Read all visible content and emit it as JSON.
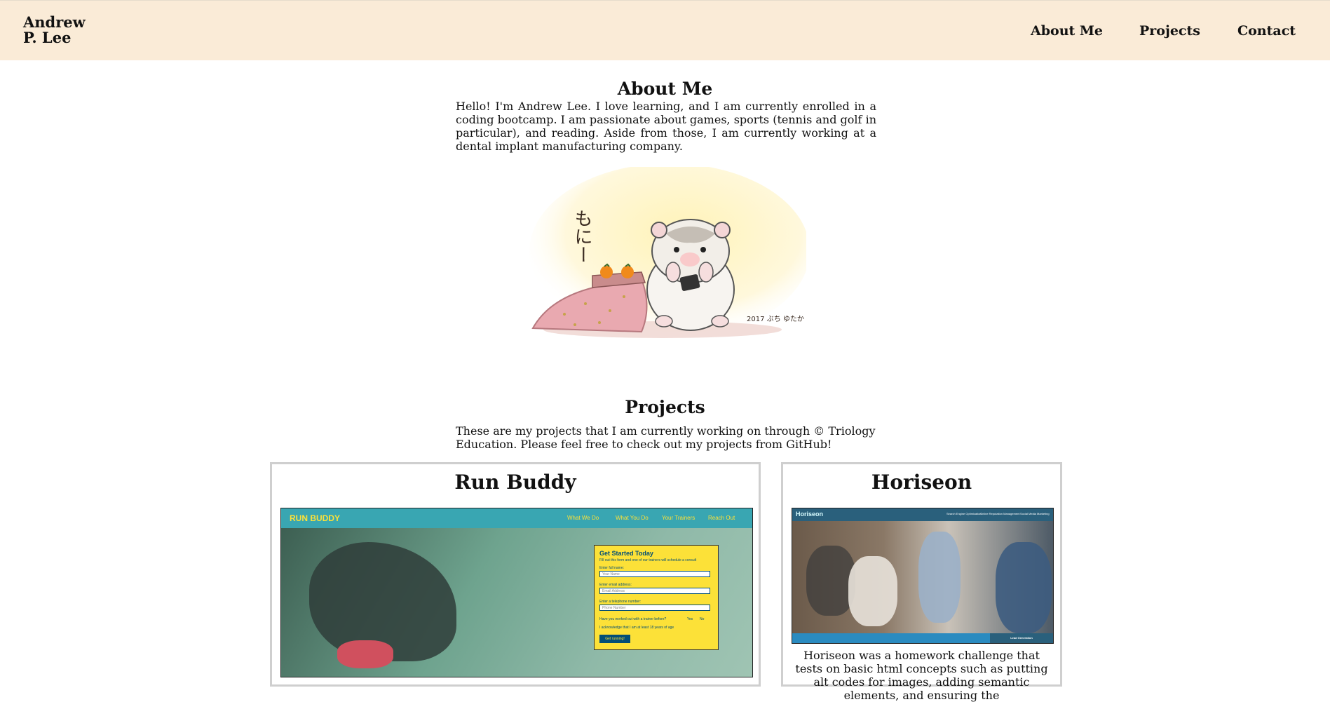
{
  "header": {
    "name_line1": "Andrew",
    "name_line2": "P. Lee",
    "nav": [
      "About Me",
      "Projects",
      "Contact"
    ]
  },
  "about": {
    "title": "About Me",
    "text": "Hello! I'm Andrew Lee. I love learning, and I am currently enrolled in a coding bootcamp. I am passionate about games, sports (tennis and golf in particular), and reading. Aside from those, I am currently working at a dental implant manufacturing company.",
    "image_caption": "もにー",
    "image_signature": "2017 ぶち ゆたか"
  },
  "projects": {
    "title": "Projects",
    "text": "These are my projects that I am currently working on through © Triology Education. Please feel free to check out my projects from GitHub!",
    "cards": [
      {
        "title": "Run Buddy",
        "screenshot": {
          "brand": "RUN BUDDY",
          "nav": [
            "What We Do",
            "What You Do",
            "Your Trainers",
            "Reach Out"
          ],
          "form_title": "Get Started Today",
          "form_sub": "Fill out this form and one of our trainers will schedule a consult",
          "fields": [
            {
              "label": "Enter full name:",
              "placeholder": "Your Name"
            },
            {
              "label": "Enter email address:",
              "placeholder": "Email Address"
            },
            {
              "label": "Enter a telephone number:",
              "placeholder": "Phone Number"
            }
          ],
          "question": "Have you worked out with a trainer before?",
          "yes": "Yes",
          "no": "No",
          "ack": "I acknowledge that I am at least 18 years of age",
          "cta": "Get running!"
        }
      },
      {
        "title": "Horiseon",
        "screenshot": {
          "brand": "Horiseon",
          "nav": [
            "Search Engine Optimization",
            "Online Reputation Management",
            "Social Media Marketing"
          ],
          "footer": "Lead Generation"
        },
        "description": "Horiseon was a homework challenge that tests on basic html concepts such as putting alt codes for images, adding semantic elements, and ensuring the"
      }
    ]
  },
  "colors": {
    "header_bg": "#faebd7",
    "runbuddy_teal": "#39a6b2",
    "runbuddy_yellow": "#fce138",
    "horiseon_navy": "#2a607c"
  }
}
